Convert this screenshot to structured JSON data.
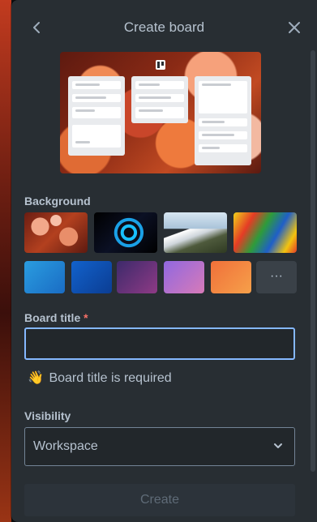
{
  "header": {
    "title": "Create board"
  },
  "background": {
    "label": "Background",
    "photos": [
      {
        "name": "flowers"
      },
      {
        "name": "blue-swirl"
      },
      {
        "name": "mountain"
      },
      {
        "name": "rainbow-feathers"
      }
    ],
    "colors": [
      "#2596d8",
      "#0f5fbd",
      "#6e3b8d",
      "#9c6adf",
      "#f07a34"
    ],
    "more_label": "···"
  },
  "board_title": {
    "label": "Board title",
    "required_mark": "*",
    "value": "",
    "hint": "Board title is required",
    "hint_icon": "👋"
  },
  "visibility": {
    "label": "Visibility",
    "selected": "Workspace"
  },
  "create_button": {
    "label": "Create"
  }
}
